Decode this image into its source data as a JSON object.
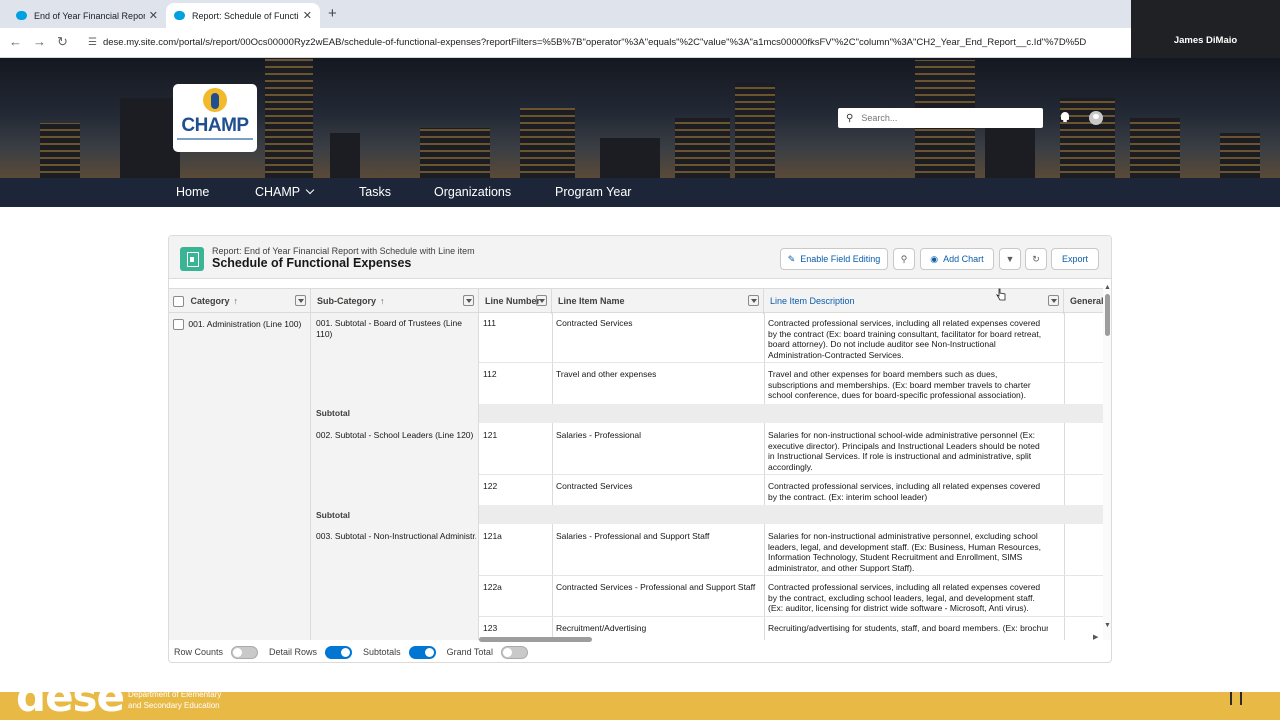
{
  "browser": {
    "tabs": [
      {
        "title": "End of Year Financial Report Su",
        "active": false
      },
      {
        "title": "Report: Schedule of Functional",
        "active": true
      }
    ],
    "url": "dese.my.site.com/portal/s/report/00Ocs00000Ryz2wEAB/schedule-of-functional-expenses?reportFilters=%5B%7B\"operator\"%3A\"equals\"%2C\"value\"%3A\"a1mcs00000fksFV\"%2C\"column\"%3A\"CH2_Year_End_Report__c.Id\"%7D%5D"
  },
  "user": {
    "name": "James DiMaio"
  },
  "site": {
    "logo_text": "CHAMP",
    "search_placeholder": "Search...",
    "nav": [
      "Home",
      "CHAMP",
      "Tasks",
      "Organizations",
      "Program Year"
    ]
  },
  "report": {
    "subtitle": "Report: End of Year Financial Report with Schedule with Line item",
    "title": "Schedule of Functional Expenses",
    "buttons": {
      "enable_field_editing": "Enable Field Editing",
      "add_chart": "Add Chart",
      "export": "Export"
    },
    "columns": [
      "Category",
      "Sub-Category",
      "Line Number",
      "Line Item Name",
      "Line Item Description",
      "General I"
    ],
    "category": "001. Administration (Line 100)",
    "subtotal_label": "Subtotal",
    "subcategories": [
      "001. Subtotal - Board of Trustees (Line 110)",
      "002. Subtotal - School Leaders (Line 120)",
      "003. Subtotal - Non-Instructional Administr..."
    ],
    "rows": [
      {
        "line": "111",
        "name": "Contracted Services",
        "desc": "Contracted professional services, including all related expenses covered by the contract (Ex: board training consultant, facilitator for board retreat, board attorney). Do not include auditor see Non-Instructional Administration-Contracted Services."
      },
      {
        "line": "112",
        "name": "Travel and other expenses",
        "desc": "Travel and other expenses for board members such as dues, subscriptions and memberships. (Ex: board member travels to charter school conference, dues for board-specific professional association)."
      },
      {
        "line": "121",
        "name": "Salaries - Professional",
        "desc": "Salaries for non-instructional school-wide administrative personnel (Ex: executive director). Principals and Instructional Leaders should be noted in Instructional Services. If role is instructional and administrative, split accordingly."
      },
      {
        "line": "122",
        "name": "Contracted Services",
        "desc": "Contracted professional services, including all related expenses covered by the contract. (Ex: interim school leader)"
      },
      {
        "line": "121a",
        "name": "Salaries - Professional and Support Staff",
        "desc": "Salaries for non-instructional administrative personnel, excluding school leaders, legal, and development staff. (Ex: Business, Human Resources, Information Technology, Student Recruitment and Enrollment, SIMS administrator, and other Support Staff)."
      },
      {
        "line": "122a",
        "name": "Contracted Services - Professional and Support Staff",
        "desc": "Contracted professional services, including all related expenses covered by the contract, excluding school leaders, legal, and development staff. (Ex: auditor, licensing for district wide software - Microsoft, Anti virus)."
      },
      {
        "line": "123",
        "name": "Recruitment/Advertising",
        "desc": "Recruiting/advertising for students, staff, and board members. (Ex: brochures,"
      }
    ],
    "toggles": [
      {
        "label": "Row Counts",
        "on": false
      },
      {
        "label": "Detail Rows",
        "on": true
      },
      {
        "label": "Subtotals",
        "on": true
      },
      {
        "label": "Grand Total",
        "on": false
      }
    ]
  },
  "footer": {
    "brand": "dese",
    "org_line1": "Department of Elementary",
    "org_line2": "and Secondary Education"
  },
  "colors": {
    "nav_bg": "#1c2638",
    "accent": "#0176d3",
    "footer_band": "#e9b945"
  }
}
